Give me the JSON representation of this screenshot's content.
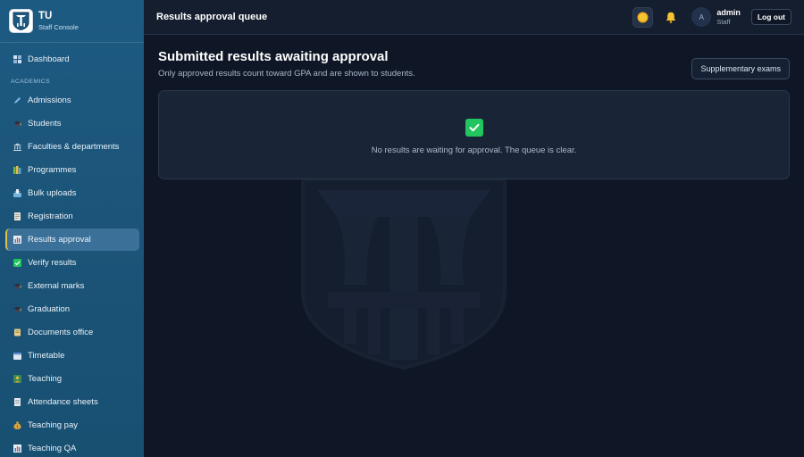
{
  "brand": {
    "name": "TU",
    "subtitle": "Staff Console"
  },
  "sidebar": {
    "section_label": "ACADEMICS",
    "items": [
      {
        "label": "Dashboard",
        "icon": "dashboard-icon",
        "color": "#8fb4d6"
      },
      {
        "label": "Admissions",
        "icon": "pencil-icon",
        "color": "#7fb7e6"
      },
      {
        "label": "Students",
        "icon": "graduation-cap-icon",
        "color": "#3b3b4f"
      },
      {
        "label": "Faculties & departments",
        "icon": "building-icon",
        "color": "#b7c4d1"
      },
      {
        "label": "Programmes",
        "icon": "books-icon",
        "color": "#7db84a"
      },
      {
        "label": "Bulk uploads",
        "icon": "inbox-tray-icon",
        "color": "#74b3dd"
      },
      {
        "label": "Registration",
        "icon": "memo-icon",
        "color": "#e8e3d6"
      },
      {
        "label": "Results approval",
        "icon": "bar-chart-icon",
        "color": "#9fc4e6",
        "active": true
      },
      {
        "label": "Verify results",
        "icon": "check-mark-icon",
        "color": "#22c55e"
      },
      {
        "label": "External marks",
        "icon": "graduation-cap-icon",
        "color": "#3b3b4f"
      },
      {
        "label": "Graduation",
        "icon": "graduation-cap-icon",
        "color": "#3b3b4f"
      },
      {
        "label": "Documents office",
        "icon": "scroll-icon",
        "color": "#e8cf8a"
      },
      {
        "label": "Timetable",
        "icon": "calendar-icon",
        "color": "#dfe7ef"
      },
      {
        "label": "Teaching",
        "icon": "teacher-icon",
        "color": "#c9a24a"
      },
      {
        "label": "Attendance sheets",
        "icon": "page-icon",
        "color": "#e5e9ee"
      },
      {
        "label": "Teaching pay",
        "icon": "money-bag-icon",
        "color": "#d9a441"
      },
      {
        "label": "Teaching QA",
        "icon": "bar-chart-icon",
        "color": "#9fc4e6"
      }
    ]
  },
  "topbar": {
    "title": "Results approval queue",
    "avatar_initial": "A",
    "user_name": "admin",
    "user_role": "Staff",
    "logout_label": "Log out"
  },
  "main": {
    "title": "Submitted results awaiting approval",
    "subtitle": "Only approved results count toward GPA and are shown to students.",
    "supplementary_label": "Supplementary exams",
    "empty_message": "No results are waiting for approval. The queue is clear."
  },
  "colors": {
    "accent": "#e3c04a",
    "success": "#22c55e",
    "sidebar": "#1d5a82",
    "background": "#0f1726"
  }
}
